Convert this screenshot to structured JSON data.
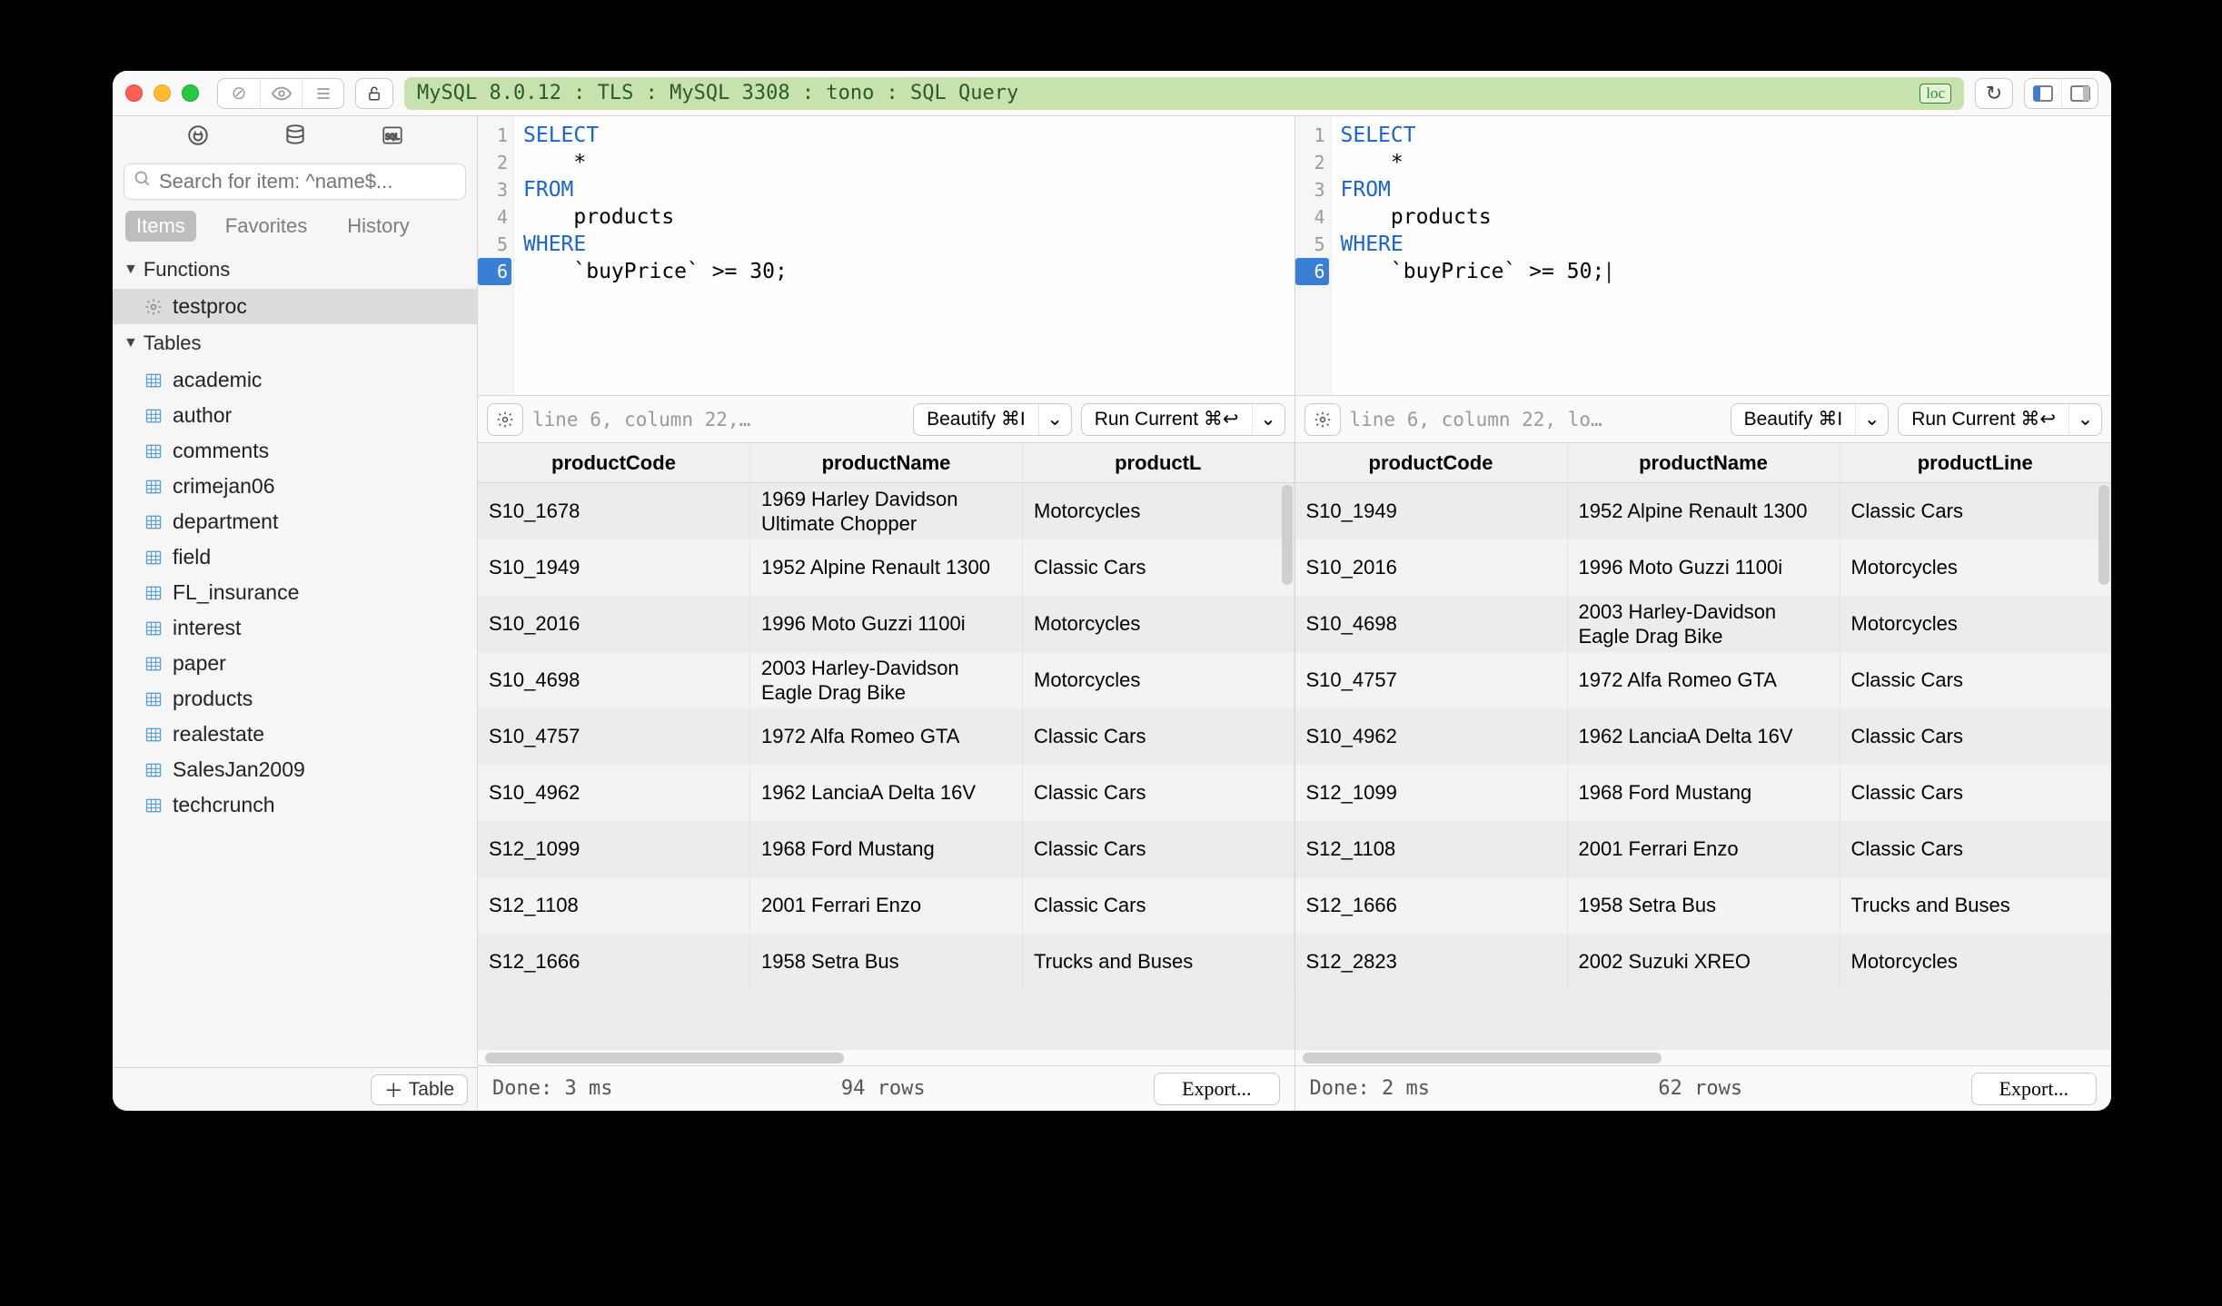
{
  "titlebar": {
    "connection": "MySQL 8.0.12 : TLS : MySQL 3308 : tono : SQL Query",
    "loc_badge": "loc"
  },
  "sidebar": {
    "search_placeholder": "Search for item: ^name$...",
    "tabs": [
      "Items",
      "Favorites",
      "History"
    ],
    "sections": {
      "functions": {
        "label": "Functions",
        "items": [
          "testproc"
        ]
      },
      "tables": {
        "label": "Tables",
        "items": [
          "academic",
          "author",
          "comments",
          "crimejan06",
          "department",
          "field",
          "FL_insurance",
          "interest",
          "paper",
          "products",
          "realestate",
          "SalesJan2009",
          "techcrunch"
        ]
      }
    },
    "add_table_label": "Table"
  },
  "panes": [
    {
      "sql": {
        "lines": [
          {
            "tokens": [
              {
                "t": "SELECT",
                "kw": true
              }
            ]
          },
          {
            "tokens": [
              {
                "t": "    *"
              }
            ]
          },
          {
            "tokens": [
              {
                "t": "FROM",
                "kw": true
              }
            ]
          },
          {
            "tokens": [
              {
                "t": "    products"
              }
            ]
          },
          {
            "tokens": [
              {
                "t": "WHERE",
                "kw": true
              }
            ]
          },
          {
            "tokens": [
              {
                "t": "    `buyPrice` >= 30;"
              }
            ]
          }
        ],
        "active_line": 6
      },
      "status": "line 6, column 22,…",
      "beautify_label": "Beautify ⌘I",
      "run_label": "Run Current ⌘↩",
      "columns": [
        "productCode",
        "productName",
        "productL"
      ],
      "rows": [
        [
          "S10_1678",
          "1969 Harley Davidson Ultimate Chopper",
          "Motorcycles"
        ],
        [
          "S10_1949",
          "1952 Alpine Renault 1300",
          "Classic Cars"
        ],
        [
          "S10_2016",
          "1996 Moto Guzzi 1100i",
          "Motorcycles"
        ],
        [
          "S10_4698",
          "2003 Harley-Davidson Eagle Drag Bike",
          "Motorcycles"
        ],
        [
          "S10_4757",
          "1972 Alfa Romeo GTA",
          "Classic Cars"
        ],
        [
          "S10_4962",
          "1962 LanciaA Delta 16V",
          "Classic Cars"
        ],
        [
          "S12_1099",
          "1968 Ford Mustang",
          "Classic Cars"
        ],
        [
          "S12_1108",
          "2001 Ferrari Enzo",
          "Classic Cars"
        ],
        [
          "S12_1666",
          "1958 Setra Bus",
          "Trucks and Buses"
        ]
      ],
      "footer": {
        "done": "Done: 3 ms",
        "rows": "94 rows",
        "export": "Export..."
      }
    },
    {
      "sql": {
        "lines": [
          {
            "tokens": [
              {
                "t": "SELECT",
                "kw": true
              }
            ]
          },
          {
            "tokens": [
              {
                "t": "    *"
              }
            ]
          },
          {
            "tokens": [
              {
                "t": "FROM",
                "kw": true
              }
            ]
          },
          {
            "tokens": [
              {
                "t": "    products"
              }
            ]
          },
          {
            "tokens": [
              {
                "t": "WHERE",
                "kw": true
              }
            ]
          },
          {
            "tokens": [
              {
                "t": "    `buyPrice` >= 50;",
                "cursor": true
              }
            ]
          }
        ],
        "active_line": 6
      },
      "status": "line 6, column 22, lo…",
      "beautify_label": "Beautify ⌘I",
      "run_label": "Run Current ⌘↩",
      "columns": [
        "productCode",
        "productName",
        "productLine"
      ],
      "rows": [
        [
          "S10_1949",
          "1952 Alpine Renault 1300",
          "Classic Cars"
        ],
        [
          "S10_2016",
          "1996 Moto Guzzi 1100i",
          "Motorcycles"
        ],
        [
          "S10_4698",
          "2003 Harley-Davidson Eagle Drag Bike",
          "Motorcycles"
        ],
        [
          "S10_4757",
          "1972 Alfa Romeo GTA",
          "Classic Cars"
        ],
        [
          "S10_4962",
          "1962 LanciaA Delta 16V",
          "Classic Cars"
        ],
        [
          "S12_1099",
          "1968 Ford Mustang",
          "Classic Cars"
        ],
        [
          "S12_1108",
          "2001 Ferrari Enzo",
          "Classic Cars"
        ],
        [
          "S12_1666",
          "1958 Setra Bus",
          "Trucks and Buses"
        ],
        [
          "S12_2823",
          "2002 Suzuki XREO",
          "Motorcycles"
        ]
      ],
      "footer": {
        "done": "Done: 2 ms",
        "rows": "62 rows",
        "export": "Export..."
      }
    }
  ]
}
